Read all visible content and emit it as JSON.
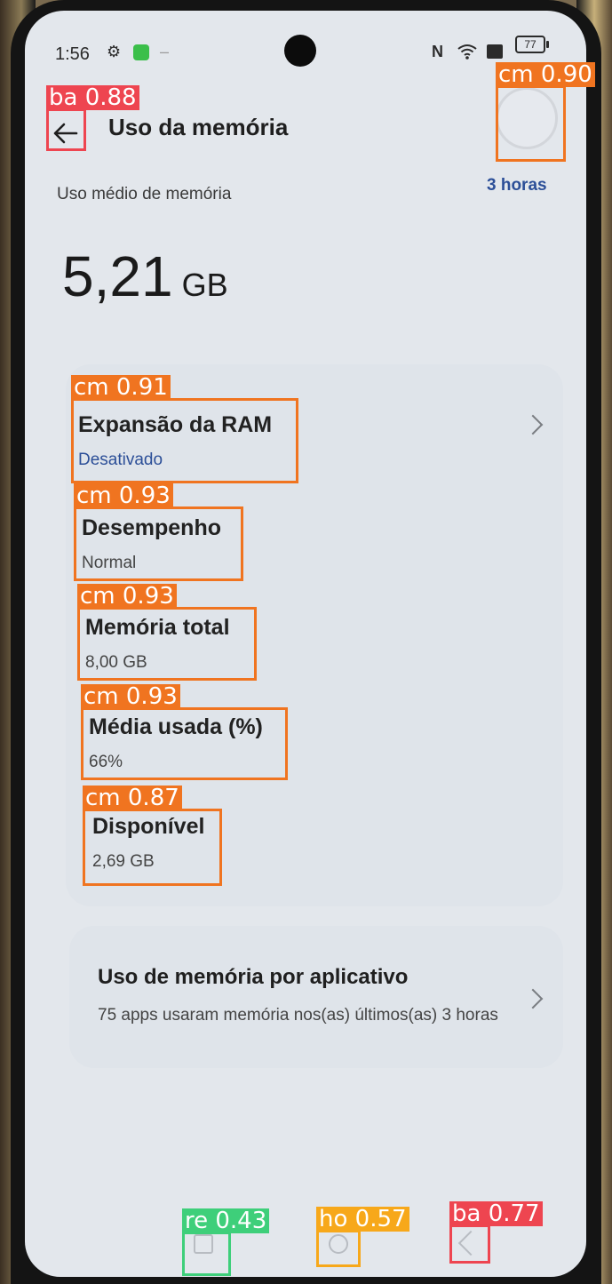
{
  "status_bar": {
    "time": "1:56",
    "icons": [
      "gear-icon",
      "app-notification-icon",
      "nfc-icon",
      "wifi-icon",
      "sim-icon"
    ],
    "battery": "77"
  },
  "header": {
    "title": "Uso da memória",
    "back_icon": "arrow-left-icon"
  },
  "summary": {
    "label": "Uso médio de memória",
    "period": "3 horas",
    "value": "5,21",
    "unit": "GB"
  },
  "stats": [
    {
      "title": "Expansão da RAM",
      "value": "Desativado",
      "accent": "#2c4f98",
      "has_chevron": true
    },
    {
      "title": "Desempenho",
      "value": "Normal"
    },
    {
      "title": "Memória total",
      "value": "8,00 GB"
    },
    {
      "title": "Média usada (%)",
      "value": "66%"
    },
    {
      "title": "Disponível",
      "value": "2,69 GB"
    }
  ],
  "app_usage": {
    "title": "Uso de memória por aplicativo",
    "subtitle": "75 apps usaram memória nos(as) últimos(as) 3 horas"
  },
  "detections": [
    {
      "label": "ba",
      "score": "0.88",
      "text": "ba 0.88",
      "color": "#ee4550"
    },
    {
      "label": "cm",
      "score": "0.90",
      "text": "cm 0.90",
      "color": "#f07420"
    },
    {
      "label": "cm",
      "score": "0.91",
      "text": "cm 0.91",
      "color": "#f07420"
    },
    {
      "label": "cm",
      "score": "0.93",
      "text": "cm 0.93",
      "color": "#f07420"
    },
    {
      "label": "cm",
      "score": "0.93",
      "text": "cm 0.93",
      "color": "#f07420"
    },
    {
      "label": "cm",
      "score": "0.93",
      "text": "cm 0.93",
      "color": "#f07420"
    },
    {
      "label": "cm",
      "score": "0.87",
      "text": "cm 0.87",
      "color": "#f07420"
    },
    {
      "label": "re",
      "score": "0.43",
      "text": "re 0.43",
      "color": "#3ecf7a"
    },
    {
      "label": "ho",
      "score": "0.57",
      "text": "ho 0.57",
      "color": "#f7a81a"
    },
    {
      "label": "ba",
      "score": "0.77",
      "text": "ba 0.77",
      "color": "#ee4550"
    }
  ],
  "navigation_bar": {
    "recent_icon": "recent-apps-icon",
    "home_icon": "home-icon",
    "back_icon": "back-icon"
  }
}
